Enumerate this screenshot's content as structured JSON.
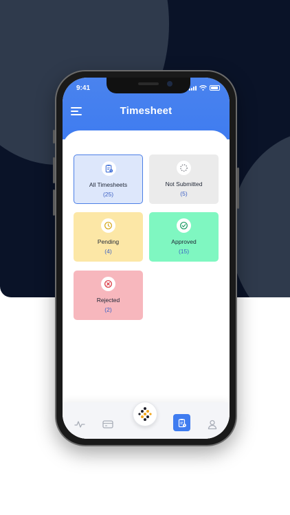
{
  "status_bar": {
    "time": "9:41"
  },
  "header": {
    "title": "Timesheet"
  },
  "cards": [
    {
      "label": "All Timesheets",
      "count": "(25)",
      "icon": "clipboard-icon"
    },
    {
      "label": "Not Submitted",
      "count": "(5)",
      "icon": "dashed-circle-icon"
    },
    {
      "label": "Pending",
      "count": "(4)",
      "icon": "clock-icon"
    },
    {
      "label": "Approved",
      "count": "(15)",
      "icon": "check-circle-icon"
    },
    {
      "label": "Rejected",
      "count": "(2)",
      "icon": "x-circle-icon"
    }
  ],
  "bottom_nav": {
    "items": [
      "activity-icon",
      "wallet-icon",
      "timesheet-icon",
      "profile-icon"
    ],
    "active": "timesheet-icon",
    "center": "app-logo"
  },
  "colors": {
    "primary": "#3f7cf0",
    "all": "#dde7fb",
    "not_submitted": "#ebebeb",
    "pending": "#fce7a6",
    "approved": "#7ff7c1",
    "rejected": "#f7b7bd"
  }
}
